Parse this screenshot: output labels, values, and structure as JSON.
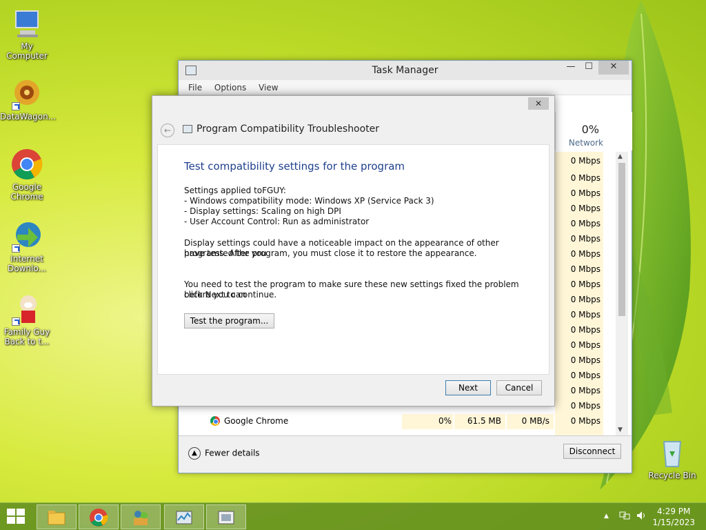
{
  "desktop": {
    "icons": [
      {
        "label": "My Computer",
        "icon": "computer-icon"
      },
      {
        "label": "DataWagon...",
        "icon": "datawagon-icon"
      },
      {
        "label": "Google Chrome",
        "icon": "chrome-icon"
      },
      {
        "label": "Internet Downlo...",
        "icon": "idm-icon"
      },
      {
        "label": "Family Guy Back to t...",
        "icon": "family-guy-icon"
      },
      {
        "label": "Recycle Bin",
        "icon": "recycle-bin-icon"
      }
    ]
  },
  "task_manager": {
    "title": "Task Manager",
    "menu": [
      "File",
      "Options",
      "View"
    ],
    "network_percent": "0%",
    "network_label": "Network",
    "network_values": [
      "0 Mbps",
      "0 Mbps",
      "0 Mbps",
      "0 Mbps",
      "0 Mbps",
      "0 Mbps",
      "0 Mbps",
      "0 Mbps",
      "0 Mbps",
      "0 Mbps",
      "0 Mbps",
      "0 Mbps",
      "0 Mbps",
      "0 Mbps",
      "0 Mbps",
      "0 Mbps",
      "0 Mbps",
      "0 Mbps"
    ],
    "visible_row": {
      "name": "Google Chrome",
      "cpu": "0%",
      "memory": "61.5 MB",
      "disk": "0 MB/s",
      "network": "0 Mbps"
    },
    "fewer_details": "Fewer details",
    "disconnect": "Disconnect"
  },
  "dialog": {
    "title": "Program Compatibility Troubleshooter",
    "heading": "Test compatibility settings for the program",
    "settings_lines": [
      "Settings applied toFGUY:",
      "- Windows compatibility mode: Windows XP (Service Pack 3)",
      "- Display settings:  Scaling on high DPI",
      "- User Account Control:  Run as administrator"
    ],
    "display_note_1": "Display settings could have a noticeable impact on the appearance of other programs.  After you",
    "display_note_2": "have tested the program, you must close it to restore the appearance.",
    "test_note_1": "You need to test the program to make sure these new settings fixed the problem before you can",
    "test_note_2": "click Next to continue.",
    "test_button": "Test the program...",
    "next": "Next",
    "cancel": "Cancel",
    "close_glyph": "✕",
    "back_glyph": "←"
  },
  "taskbar": {
    "time": "4:29 PM",
    "date": "1/15/2023",
    "tray_arrow": "▲"
  },
  "colors": {
    "heading": "#1e3f8c",
    "accent": "#3c7fb1",
    "desktop": "#c9e02f"
  }
}
